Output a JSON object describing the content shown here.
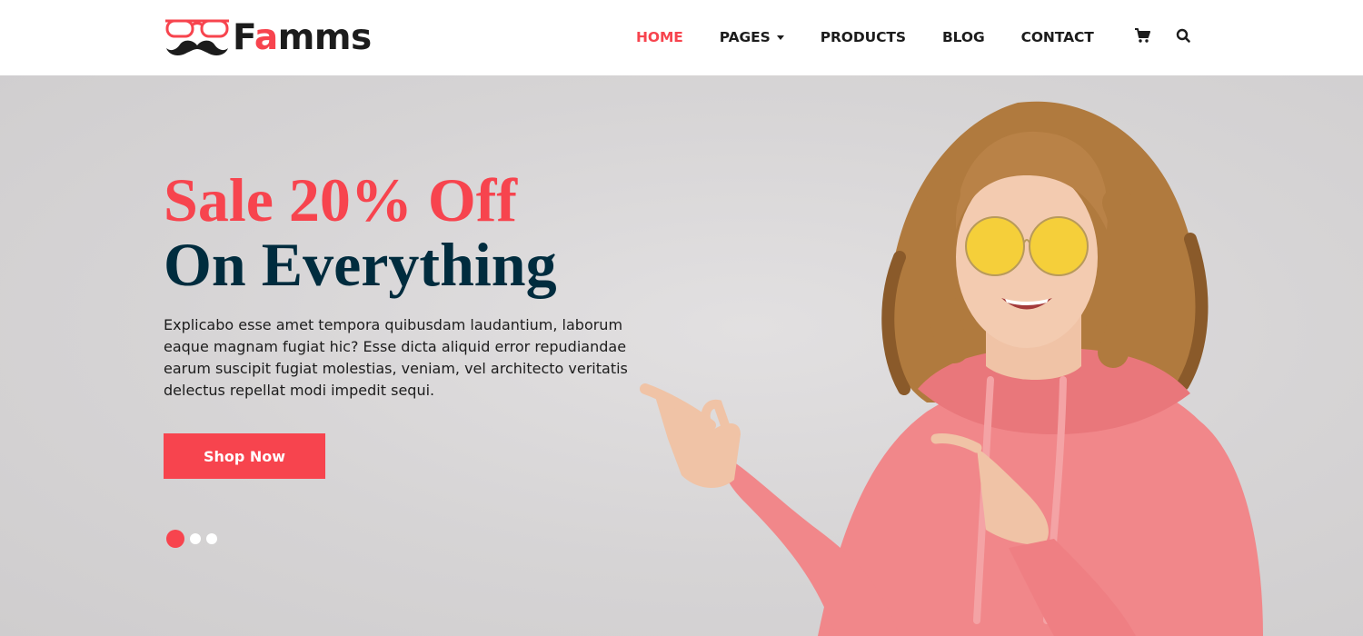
{
  "brand": {
    "name_prefix": "F",
    "name_accent": "a",
    "name_suffix": "mms",
    "logo_icon": "glasses-mustache-icon",
    "accent_color": "#f7444e",
    "dark_color": "#002c3e"
  },
  "nav": {
    "items": [
      {
        "label": "HOME",
        "active": true
      },
      {
        "label": "PAGES",
        "has_dropdown": true
      },
      {
        "label": "PRODUCTS"
      },
      {
        "label": "BLOG"
      },
      {
        "label": "CONTACT"
      }
    ],
    "cart_icon": "shopping-cart-icon",
    "search_icon": "search-icon"
  },
  "hero": {
    "title_line1": "Sale 20% Off",
    "title_line2": "On Everything",
    "description": "Explicabo esse amet tempora quibusdam laudantium, laborum eaque magnam fugiat hic? Esse dicta aliquid error repudiandae earum suscipit fugiat molestias, veniam, vel architecto veritatis delectus repellat modi impedit sequi.",
    "button_label": "Shop Now",
    "slider": {
      "total": 3,
      "active_index": 0
    }
  }
}
